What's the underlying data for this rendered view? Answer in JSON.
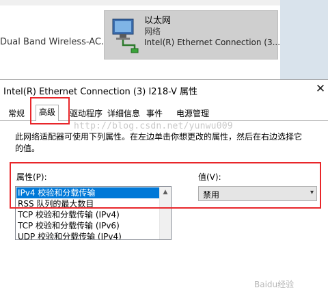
{
  "background": {
    "wifi_adapter_text": "Dual Band Wireless-AC...",
    "ethernet_tile": {
      "title": "以太网",
      "status": "网络",
      "device": "Intel(R) Ethernet Connection (3..."
    }
  },
  "dialog": {
    "title": "Intel(R) Ethernet Connection (3) I218-V 属性",
    "close_glyph": "✕",
    "tabs": [
      {
        "label": "常规"
      },
      {
        "label": "高级",
        "active": true
      },
      {
        "label": "驱动程序"
      },
      {
        "label": "详细信息"
      },
      {
        "label": "事件"
      },
      {
        "label": "电源管理"
      }
    ],
    "advanced": {
      "description": "此网络适配器可使用下列属性。在左边单击你想更改的属性，然后在右边选择它的值。",
      "property_label": "属性(P):",
      "value_label": "值(V):",
      "properties": [
        "IPv4 校验和分载传输",
        "RSS 队列的最大数目",
        "TCP 校验和分载传输 (IPv4)",
        "TCP 校验和分载传输 (IPv6)",
        "UDP 校验和分载传输 (IPv4)"
      ],
      "selected_index": 0,
      "value": "禁用"
    }
  },
  "watermark": "http://blog.csdn.net/yunwu009",
  "corner_watermark": "Baidu经验",
  "colors": {
    "highlight": "#e8262a",
    "selection": "#0078d7"
  }
}
